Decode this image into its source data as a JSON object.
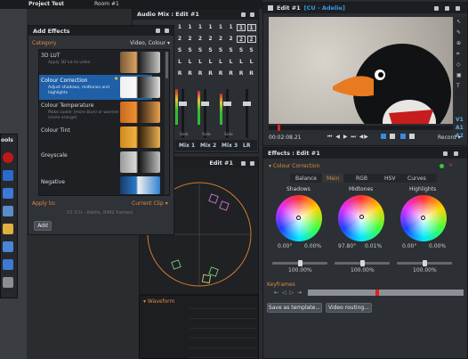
{
  "window_tabs": {
    "project": "Project Test",
    "room": "Room #1"
  },
  "add_effects": {
    "title": "Add Effects",
    "category_label": "Category",
    "category_value": "Video, Colour",
    "items": [
      {
        "name": "3D LUT",
        "desc": "Apply 3D lut to video"
      },
      {
        "name": "Colour Correction",
        "desc": "Adjust shadows, midtones and highlights"
      },
      {
        "name": "Colour Temperature",
        "desc": "Make cooler (more blue) or warmer (more orange)"
      },
      {
        "name": "Colour Tint",
        "desc": ""
      },
      {
        "name": "Greyscale",
        "desc": ""
      },
      {
        "name": "Negative",
        "desc": ""
      }
    ],
    "apply_to_label": "Apply to:",
    "apply_to_value": "Current Clip",
    "clip_info": "V1 (CU - Adelie, 8492 frames)",
    "add_button": "Add"
  },
  "audio_mix": {
    "title": "Audio Mix : Edit #1",
    "row1": [
      "1",
      "1",
      "1",
      "1",
      "1",
      "1",
      "1",
      "1"
    ],
    "row2": [
      "2",
      "2",
      "2",
      "2",
      "2",
      "2",
      "2",
      "2"
    ],
    "row3": [
      "S",
      "S",
      "S",
      "S",
      "S",
      "S",
      "S",
      "S"
    ],
    "row4": [
      "L",
      "L",
      "L",
      "L",
      "L",
      "L",
      "L",
      "L"
    ],
    "row5": [
      "R",
      "R",
      "R",
      "R",
      "R",
      "R",
      "R",
      "R"
    ],
    "mute_label": "Solo",
    "channels": [
      "Mix 1",
      "Mix 2",
      "Mix 3",
      "LR"
    ]
  },
  "tools_label": "ools",
  "scope": {
    "title": "Edit #1"
  },
  "waveform": {
    "title": "Waveform"
  },
  "viewer": {
    "title": "Edit #1",
    "subtitle": "[CU - Adelie]",
    "timecode": "00:02:08.21",
    "record_label": "Record",
    "track_labels": [
      "V1",
      "A1",
      "A2"
    ]
  },
  "effects_panel": {
    "title": "Effects : Edit #1",
    "effect_name": "Colour Correction",
    "tabs": [
      "Balance",
      "Main",
      "RGB",
      "HSV",
      "Curves"
    ],
    "active_tab": "Main",
    "wheels": [
      {
        "label": "Shadows",
        "v1": "0.00°",
        "v2": "0.00%",
        "pct": "100.00%"
      },
      {
        "label": "Midtones",
        "v1": "97.80°",
        "v2": "0.01%",
        "pct": "100.00%"
      },
      {
        "label": "Highlights",
        "v1": "0.00°",
        "v2": "0.00%",
        "pct": "100.00%"
      }
    ],
    "keyframes_label": "Keyframes",
    "save_template": "Save as template...",
    "video_routing": "Video routing..."
  }
}
